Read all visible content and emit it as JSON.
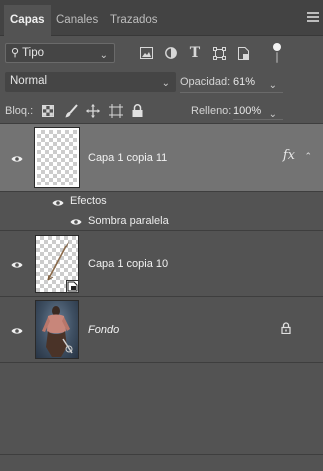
{
  "tabs": [
    {
      "label": "Capas",
      "active": true
    },
    {
      "label": "Canales",
      "active": false
    },
    {
      "label": "Trazados",
      "active": false
    }
  ],
  "filter": {
    "kind_label": "Tipo",
    "icons": [
      "image-filter-icon",
      "adjustment-filter-icon",
      "type-filter-icon",
      "shape-filter-icon",
      "smart-object-filter-icon",
      "filter-toggle-icon"
    ]
  },
  "blend": {
    "mode": "Normal",
    "opacity_label": "Opacidad:",
    "opacity_value": "61%"
  },
  "lock": {
    "label": "Bloq.:",
    "icons": [
      "lock-transparent-pixels-icon",
      "lock-image-pixels-icon",
      "lock-position-icon",
      "lock-artboard-icon",
      "lock-all-icon"
    ],
    "fill_label": "Relleno:",
    "fill_value": "100%"
  },
  "layers": [
    {
      "name": "Capa 1 copia 11",
      "visible": true,
      "selected": true,
      "fx": "fx",
      "effects_label": "Efectos",
      "effects": [
        "Sombra paralela"
      ]
    },
    {
      "name": "Capa 1 copia 10",
      "visible": true,
      "selected": false
    },
    {
      "name": "Fondo",
      "visible": true,
      "selected": false,
      "locked": true,
      "italic": true
    }
  ],
  "colors": {
    "panel": "#535353",
    "selected_row": "#737373",
    "tabbar": "#434343"
  }
}
